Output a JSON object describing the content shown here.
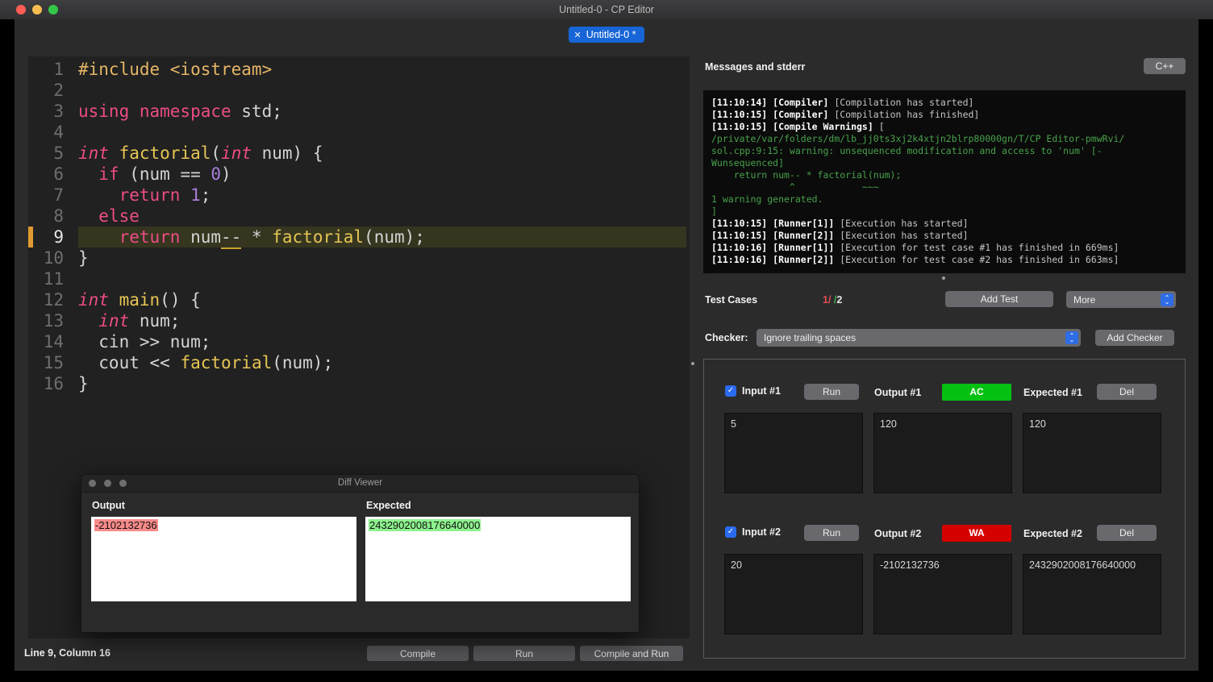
{
  "window": {
    "title": "Untitled-0 - CP Editor",
    "tab": {
      "close": "✕",
      "label": "Untitled-0 *"
    }
  },
  "icons": {
    "check": "✓",
    "chevron_up": "⌃",
    "chevron_down": "⌄"
  },
  "editor": {
    "current_line": 9,
    "status": "Line 9, Column 16",
    "lines": [
      {
        "n": 1,
        "seg": [
          {
            "t": "#include <iostream>",
            "c": "pp"
          }
        ]
      },
      {
        "n": 2,
        "seg": []
      },
      {
        "n": 3,
        "seg": [
          {
            "t": "using namespace",
            "c": "kw"
          },
          {
            "t": " std;",
            "c": "pl"
          }
        ]
      },
      {
        "n": 4,
        "seg": []
      },
      {
        "n": 5,
        "seg": [
          {
            "t": "int",
            "c": "ty"
          },
          {
            "t": " ",
            "c": "pl"
          },
          {
            "t": "factorial",
            "c": "fn"
          },
          {
            "t": "(",
            "c": "pl"
          },
          {
            "t": "int",
            "c": "ty"
          },
          {
            "t": " num) {",
            "c": "pl"
          }
        ]
      },
      {
        "n": 6,
        "seg": [
          {
            "t": "  ",
            "c": "pl"
          },
          {
            "t": "if",
            "c": "kw"
          },
          {
            "t": " (num == ",
            "c": "pl"
          },
          {
            "t": "0",
            "c": "nu"
          },
          {
            "t": ")",
            "c": "pl"
          }
        ]
      },
      {
        "n": 7,
        "seg": [
          {
            "t": "    ",
            "c": "pl"
          },
          {
            "t": "return",
            "c": "kw"
          },
          {
            "t": " ",
            "c": "pl"
          },
          {
            "t": "1",
            "c": "nu"
          },
          {
            "t": ";",
            "c": "pl"
          }
        ]
      },
      {
        "n": 8,
        "seg": [
          {
            "t": "  ",
            "c": "pl"
          },
          {
            "t": "else",
            "c": "kw"
          }
        ]
      },
      {
        "n": 9,
        "seg": [
          {
            "t": "    ",
            "c": "pl"
          },
          {
            "t": "return",
            "c": "kw"
          },
          {
            "t": " num",
            "c": "pl"
          },
          {
            "t": "--",
            "c": "ul"
          },
          {
            "t": " * ",
            "c": "pl"
          },
          {
            "t": "factorial",
            "c": "fn"
          },
          {
            "t": "(num);",
            "c": "pl"
          }
        ]
      },
      {
        "n": 10,
        "seg": [
          {
            "t": "}",
            "c": "pl"
          }
        ]
      },
      {
        "n": 11,
        "seg": []
      },
      {
        "n": 12,
        "seg": [
          {
            "t": "int",
            "c": "ty"
          },
          {
            "t": " ",
            "c": "pl"
          },
          {
            "t": "main",
            "c": "fn"
          },
          {
            "t": "() {",
            "c": "pl"
          }
        ]
      },
      {
        "n": 13,
        "seg": [
          {
            "t": "  ",
            "c": "pl"
          },
          {
            "t": "int",
            "c": "ty"
          },
          {
            "t": " num;",
            "c": "pl"
          }
        ]
      },
      {
        "n": 14,
        "seg": [
          {
            "t": "  cin >> num;",
            "c": "pl"
          }
        ]
      },
      {
        "n": 15,
        "seg": [
          {
            "t": "  cout << ",
            "c": "pl"
          },
          {
            "t": "factorial",
            "c": "fn"
          },
          {
            "t": "(num);",
            "c": "pl"
          }
        ]
      },
      {
        "n": 16,
        "seg": [
          {
            "t": "}",
            "c": "pl"
          }
        ]
      }
    ]
  },
  "toolbar": {
    "compile": "Compile",
    "run": "Run",
    "compile_and_run": "Compile and Run"
  },
  "messages": {
    "title": "Messages and stderr",
    "language": "C++",
    "log": [
      [
        {
          "t": "[11:10:14] [Compiler] ",
          "c": "b"
        },
        {
          "t": "[Compilation has started]",
          "c": "n"
        }
      ],
      [
        {
          "t": "[11:10:15] [Compiler] ",
          "c": "b"
        },
        {
          "t": "[Compilation has finished]",
          "c": "n"
        }
      ],
      [
        {
          "t": "[11:10:15] [Compile Warnings] ",
          "c": "b"
        },
        {
          "t": "[",
          "c": "n"
        }
      ],
      [
        {
          "t": "/private/var/folders/dm/lb_jj0ts3xj2k4xtjn2blrp80000gn/T/CP Editor-pmwRvi/",
          "c": "g"
        }
      ],
      [
        {
          "t": "sol.cpp:9:15: warning: unsequenced modification and access to 'num' [-",
          "c": "g"
        }
      ],
      [
        {
          "t": "Wunsequenced]",
          "c": "g"
        }
      ],
      [
        {
          "t": "    return num-- * factorial(num);",
          "c": "g"
        }
      ],
      [
        {
          "t": "              ^            ~~~",
          "c": "g"
        }
      ],
      [
        {
          "t": "1 warning generated.",
          "c": "g"
        }
      ],
      [
        {
          "t": "]",
          "c": "g"
        }
      ],
      [
        {
          "t": "[11:10:15] [Runner[1]] ",
          "c": "b"
        },
        {
          "t": "[Execution has started]",
          "c": "n"
        }
      ],
      [
        {
          "t": "[11:10:15] [Runner[2]] ",
          "c": "b"
        },
        {
          "t": "[Execution has started]",
          "c": "n"
        }
      ],
      [
        {
          "t": "[11:10:16] [Runner[1]] ",
          "c": "b"
        },
        {
          "t": "[Execution for test case #1 has finished in 669ms]",
          "c": "n"
        }
      ],
      [
        {
          "t": "[11:10:16] [Runner[2]] ",
          "c": "b"
        },
        {
          "t": "[Execution for test case #2 has finished in 663ms]",
          "c": "n"
        }
      ]
    ]
  },
  "test_cases": {
    "title": "Test Cases",
    "summary": [
      {
        "t": "1",
        "c": "sr"
      },
      {
        "t": "/",
        "c": "sr"
      },
      {
        "t": " ",
        "c": "sp"
      },
      {
        "t": "/",
        "c": "sg"
      },
      {
        "t": "2",
        "c": "sp"
      }
    ],
    "add_test": "Add Test",
    "more": "More",
    "checker_label": "Checker:",
    "checker_value": "Ignore trailing spaces",
    "add_checker": "Add Checker",
    "cases": [
      {
        "input_label": "Input #1",
        "run": "Run",
        "output_label": "Output #1",
        "verdict": "AC",
        "expected_label": "Expected #1",
        "del": "Del",
        "input": "5",
        "output": "120",
        "expected": "120"
      },
      {
        "input_label": "Input #2",
        "run": "Run",
        "output_label": "Output #2",
        "verdict": "WA",
        "expected_label": "Expected #2",
        "del": "Del",
        "input": "20",
        "output": "-2102132736",
        "expected": "2432902008176640000"
      }
    ]
  },
  "diff_viewer": {
    "title": "Diff Viewer",
    "output_label": "Output",
    "expected_label": "Expected",
    "output_value": "-2102132736",
    "expected_value": "2432902008176640000"
  },
  "colors": {
    "accent_blue": "#1765d6",
    "verdict_ac": "#04c112",
    "verdict_wa": "#d50000",
    "warning_green": "#47a14b",
    "current_line_marker": "#e09a2f"
  }
}
